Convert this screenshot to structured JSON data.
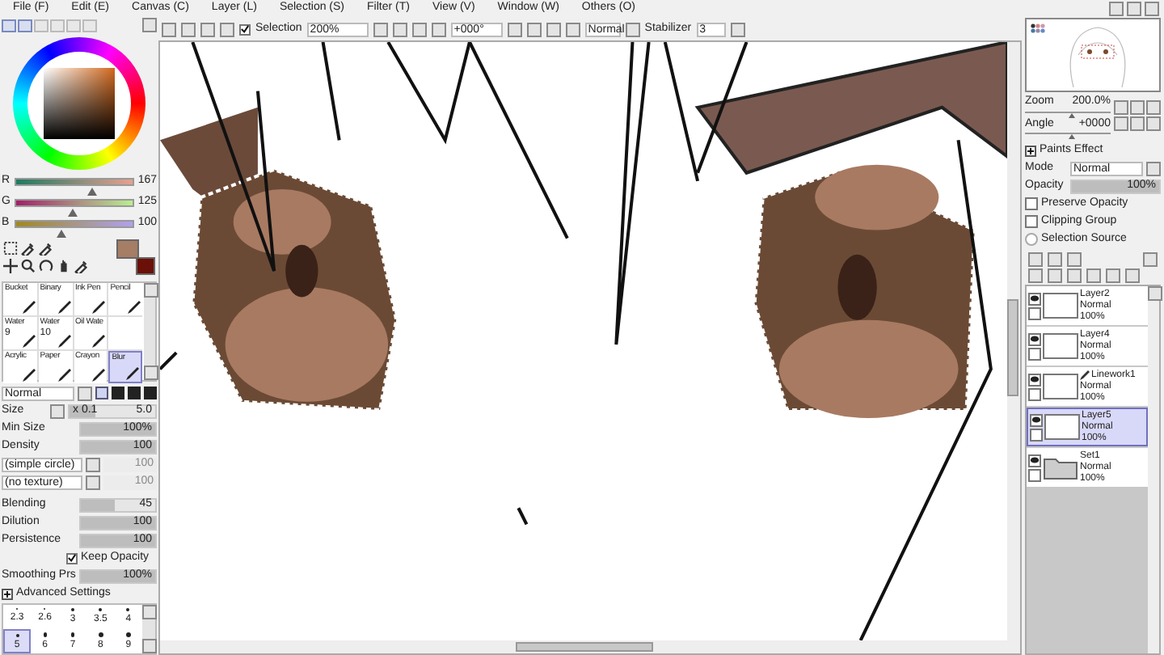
{
  "menu": [
    "File (F)",
    "Edit (E)",
    "Canvas (C)",
    "Layer (L)",
    "Selection (S)",
    "Filter (T)",
    "View (V)",
    "Window (W)",
    "Others (O)"
  ],
  "toolbar": {
    "selection": {
      "label": "Selection",
      "checked": true
    },
    "zoom": "200%",
    "angle": "+000°",
    "blend_mode": "Normal",
    "stabilizer_label": "Stabilizer",
    "stabilizer": "3"
  },
  "color_sliders": [
    {
      "label": "R",
      "value": "167",
      "level": 0.65
    },
    {
      "label": "G",
      "value": "125",
      "level": 0.49
    },
    {
      "label": "B",
      "value": "100",
      "level": 0.39
    }
  ],
  "brushes": [
    {
      "label": "Bucket",
      "selected": false
    },
    {
      "label": "Binary",
      "selected": false
    },
    {
      "label": "Ink Pen",
      "selected": false
    },
    {
      "label": "Pencil",
      "selected": false
    },
    {
      "label": "Water",
      "size": "9",
      "selected": false
    },
    {
      "label": "Water",
      "size": "10",
      "selected": false
    },
    {
      "label": "Oil Wate",
      "selected": false
    },
    {
      "selected": false
    },
    {
      "label": "Acrylic",
      "selected": false
    },
    {
      "label": "Paper",
      "selected": false
    },
    {
      "label": "Crayon",
      "selected": false
    },
    {
      "label": "Blur",
      "selected": true
    }
  ],
  "brush_mode": "Normal",
  "settings": [
    {
      "kind": "size",
      "label": "Size",
      "multiplier": "x 0.1",
      "value": "5.0",
      "level": 0.3
    },
    {
      "kind": "bar",
      "label": "Min Size",
      "value": "100%",
      "level": 1
    },
    {
      "kind": "bar",
      "label": "Density",
      "value": "100",
      "level": 1
    },
    {
      "kind": "select",
      "label": "(simple circle)",
      "value": "100",
      "disabled": true
    },
    {
      "kind": "select",
      "label": "(no texture)",
      "value": "100",
      "disabled": true
    },
    {
      "kind": "bar",
      "label": "Blending",
      "value": "45",
      "level": 0.45
    },
    {
      "kind": "bar",
      "label": "Dilution",
      "value": "100",
      "level": 1
    },
    {
      "kind": "bar",
      "label": "Persistence",
      "value": "100",
      "level": 1
    },
    {
      "kind": "check",
      "label": "Keep Opacity",
      "checked": true
    },
    {
      "kind": "bar",
      "label": "Smoothing Prs",
      "value": "100%",
      "level": 1
    }
  ],
  "advanced_settings": "Advanced Settings",
  "size_presets": [
    {
      "label": "2.3",
      "selected": false
    },
    {
      "label": "2.6",
      "selected": false
    },
    {
      "label": "3",
      "selected": false
    },
    {
      "label": "3.5",
      "selected": false
    },
    {
      "label": "4",
      "selected": false
    },
    {
      "label": "5",
      "selected": true
    },
    {
      "label": "6",
      "selected": false
    },
    {
      "label": "7",
      "selected": false
    },
    {
      "label": "8",
      "selected": false
    },
    {
      "label": "9",
      "selected": false
    }
  ],
  "navigator": {
    "zoom": {
      "label": "Zoom",
      "value": "200.0%",
      "level": 0.5
    },
    "angle": {
      "label": "Angle",
      "value": "+0000",
      "level": 0.5
    }
  },
  "paints_effect": "Paints Effect",
  "layer_props": {
    "mode_label": "Mode",
    "mode": "Normal",
    "opacity": {
      "label": "Opacity",
      "value": "100%",
      "level": 1
    }
  },
  "layer_options": [
    {
      "label": "Preserve Opacity",
      "checked": false
    },
    {
      "label": "Clipping Group",
      "checked": false
    },
    {
      "label": "Selection Source",
      "checked": false
    }
  ],
  "layers": [
    {
      "kind": "layer",
      "name": "Layer2",
      "mode": "Normal",
      "opacity": "100%",
      "visible": true,
      "selected": false
    },
    {
      "kind": "layer",
      "name": "Layer4",
      "mode": "Normal",
      "opacity": "100%",
      "visible": true,
      "selected": false
    },
    {
      "kind": "linework",
      "name": "Linework1",
      "mode": "Normal",
      "opacity": "100%",
      "visible": true,
      "selected": false
    },
    {
      "kind": "layer",
      "name": "Layer5",
      "mode": "Normal",
      "opacity": "100%",
      "visible": true,
      "selected": true
    },
    {
      "kind": "folder",
      "name": "Set1",
      "mode": "Normal",
      "opacity": "100%",
      "visible": true,
      "selected": false
    }
  ]
}
